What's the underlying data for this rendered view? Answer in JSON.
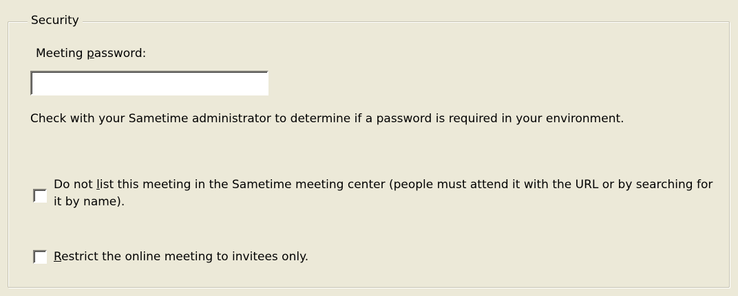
{
  "security": {
    "title": "Security",
    "password": {
      "label": "Meeting password:",
      "label_before_accel": "Meeting ",
      "label_accel": "p",
      "label_after_accel": "assword:",
      "value": ""
    },
    "info_text": "Check with your Sametime administrator to determine if a password is required in your environment.",
    "options": [
      {
        "label": "Do not list this meeting in the Sametime meeting center (people must attend it with the URL or by searching for it by name).",
        "label_before_accel": "Do not ",
        "label_accel": "l",
        "label_after_accel": "ist this meeting in the Sametime meeting center (people must attend it with the URL or by searching for it by name).",
        "checked": false
      },
      {
        "label": "Restrict the online meeting to invitees only.",
        "label_before_accel": "",
        "label_accel": "R",
        "label_after_accel": "estrict the online meeting to invitees only.",
        "checked": false
      }
    ]
  }
}
